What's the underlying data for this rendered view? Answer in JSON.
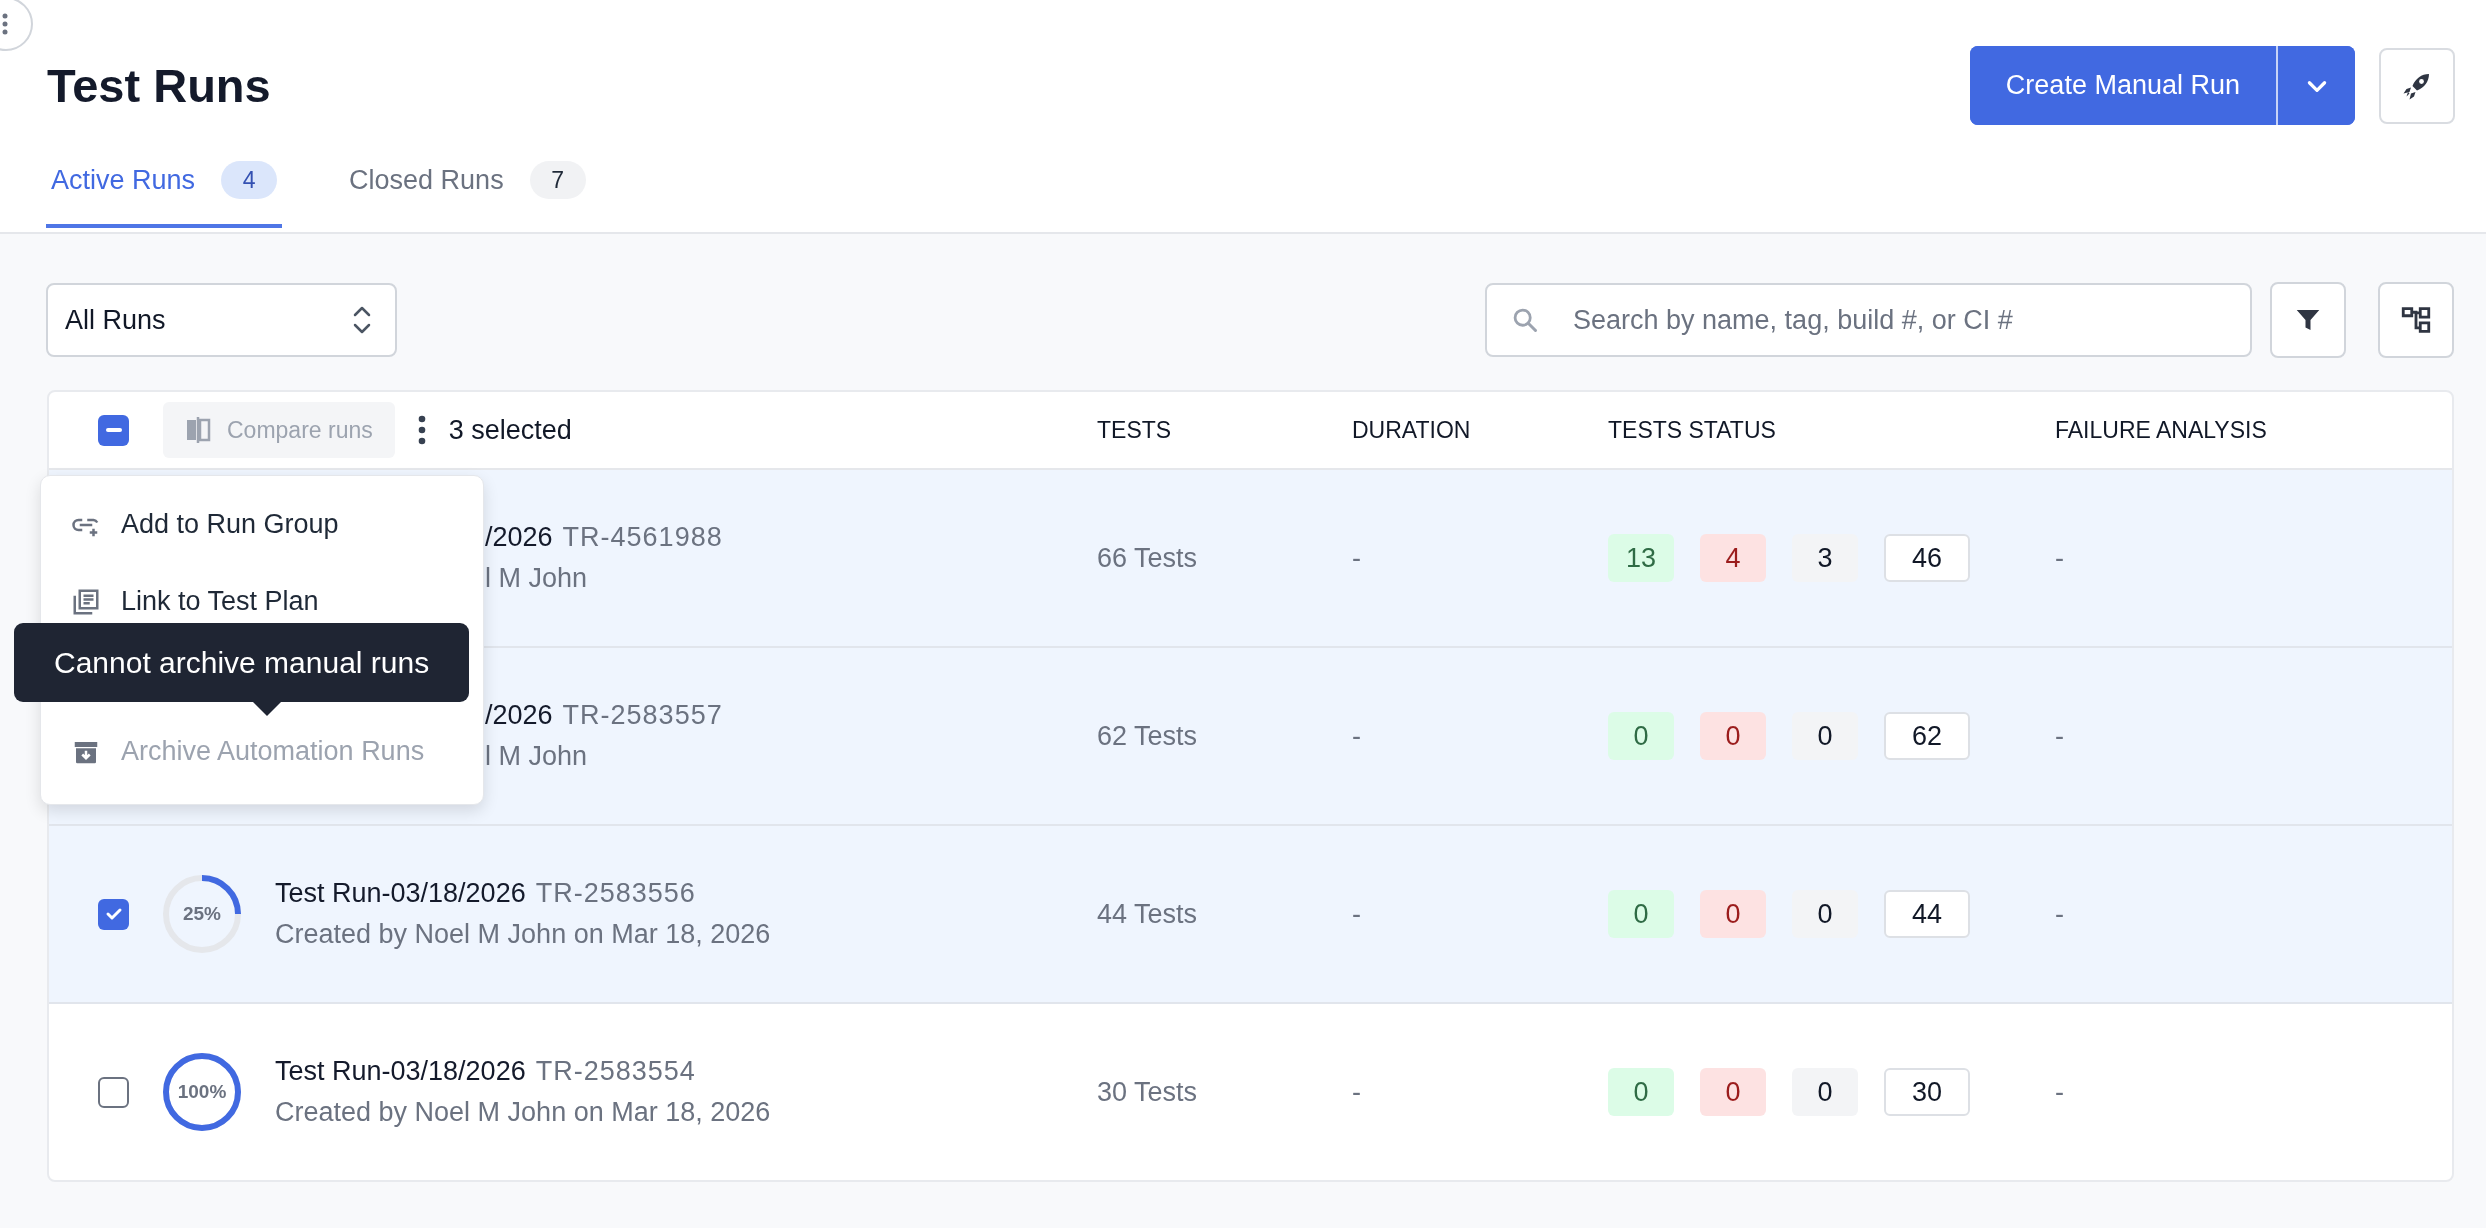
{
  "title": "Test Runs",
  "tabs": [
    {
      "label": "Active Runs",
      "count": "4",
      "selected": true
    },
    {
      "label": "Closed Runs",
      "count": "7",
      "selected": false
    }
  ],
  "primary_action": {
    "label": "Create Manual Run"
  },
  "filter_select": {
    "value": "All Runs"
  },
  "search": {
    "placeholder": "Search by name, tag, build #, or CI #"
  },
  "table": {
    "bulk": {
      "checked": true,
      "indeterminate": true,
      "compare_button": {
        "label": "Compare runs",
        "disabled": true
      },
      "selected_count": "3 selected"
    },
    "columns": [
      "TESTS",
      "DURATION",
      "TESTS STATUS",
      "FAILURE ANALYSIS"
    ],
    "rows": [
      {
        "kind": "obscured",
        "selected": true,
        "title": "/2026",
        "run_id": "TR-4561988",
        "subtitle": "l M John",
        "tests": "66 Tests",
        "duration": "-",
        "status": [
          {
            "kind": "passed",
            "value": "13"
          },
          {
            "kind": "failed",
            "value": "4"
          },
          {
            "kind": "skipped",
            "value": "3"
          },
          {
            "kind": "total",
            "value": "46"
          }
        ],
        "failure_analysis": "-"
      },
      {
        "kind": "obscured",
        "selected": true,
        "title": "/2026",
        "run_id": "TR-2583557",
        "subtitle": "l M John",
        "tests": "62 Tests",
        "duration": "-",
        "status": [
          {
            "kind": "passed",
            "value": "0"
          },
          {
            "kind": "failed",
            "value": "0"
          },
          {
            "kind": "skipped",
            "value": "0"
          },
          {
            "kind": "total",
            "value": "62"
          }
        ],
        "failure_analysis": "-"
      },
      {
        "kind": "full",
        "selected": true,
        "progress": {
          "level": 0.25,
          "label": "25%"
        },
        "title": "Test Run-03/18/2026",
        "run_id": "TR-2583556",
        "subtitle": "Created by Noel M John on Mar 18, 2026",
        "tests": "44 Tests",
        "duration": "-",
        "status": [
          {
            "kind": "passed",
            "value": "0"
          },
          {
            "kind": "failed",
            "value": "0"
          },
          {
            "kind": "skipped",
            "value": "0"
          },
          {
            "kind": "total",
            "value": "44"
          }
        ],
        "failure_analysis": "-"
      },
      {
        "kind": "full",
        "selected": false,
        "progress": {
          "level": 1,
          "label": "100%"
        },
        "title": "Test Run-03/18/2026",
        "run_id": "TR-2583554",
        "subtitle": "Created by Noel M John on Mar 18, 2026",
        "tests": "30 Tests",
        "duration": "-",
        "status": [
          {
            "kind": "passed",
            "value": "0"
          },
          {
            "kind": "failed",
            "value": "0"
          },
          {
            "kind": "skipped",
            "value": "0"
          },
          {
            "kind": "total",
            "value": "30"
          }
        ],
        "failure_analysis": "-"
      }
    ]
  },
  "actions_menu": {
    "items": [
      {
        "kind": "group",
        "label": "Add to Run Group",
        "disabled": false
      },
      {
        "kind": "plan",
        "label": "Link to Test Plan",
        "disabled": false
      },
      {
        "kind": "archive",
        "label": "Archive Automation Runs",
        "disabled": true
      }
    ]
  },
  "tooltip": "Cannot archive manual runs"
}
